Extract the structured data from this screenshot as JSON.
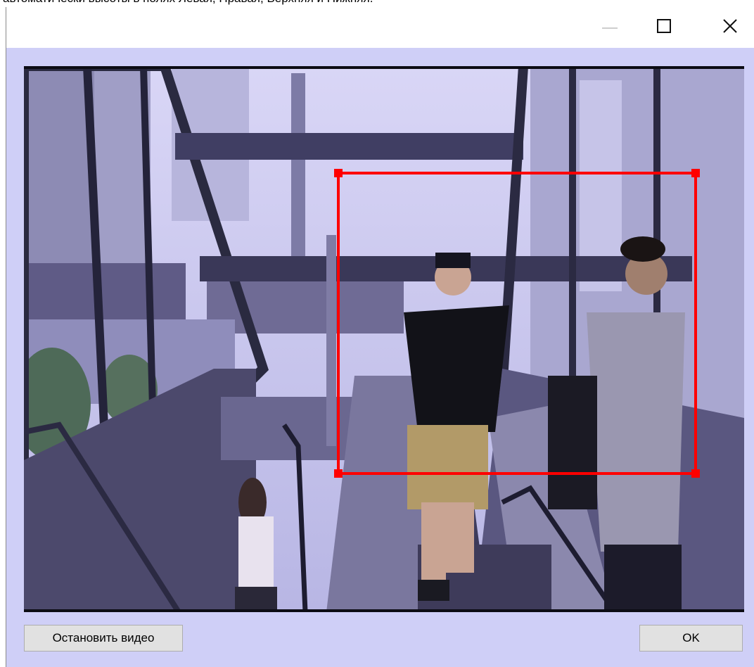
{
  "background_text": "автоматически высоты в полях Левая, Правая, Верхняя и Нижняя.",
  "window": {
    "controls": {
      "minimize": "minimize-icon",
      "maximize": "maximize-icon",
      "close": "close-icon"
    }
  },
  "video": {
    "selection_color": "#ff0000"
  },
  "buttons": {
    "stop_video": "Остановить видео",
    "ok": "OK"
  }
}
